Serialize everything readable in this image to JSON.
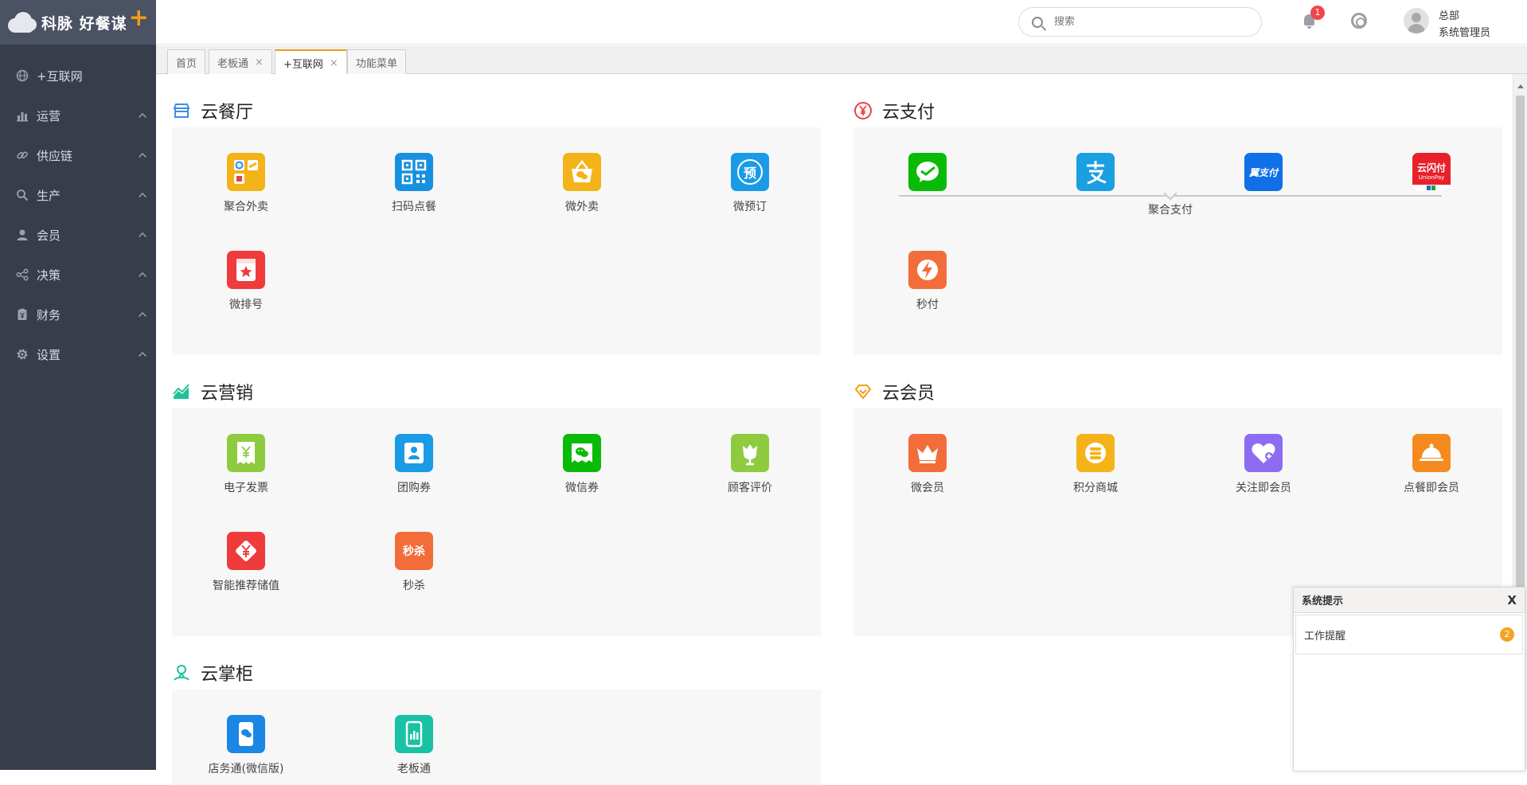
{
  "brand": {
    "name": "科脉 好餐谋",
    "plus": "+"
  },
  "sidebar": {
    "items": [
      {
        "label": "+互联网",
        "icon": "globe-icon"
      },
      {
        "label": "运营",
        "icon": "bar-chart-icon"
      },
      {
        "label": "供应链",
        "icon": "link-icon"
      },
      {
        "label": "生产",
        "icon": "search-icon"
      },
      {
        "label": "会员",
        "icon": "user-icon"
      },
      {
        "label": "决策",
        "icon": "share-icon"
      },
      {
        "label": "财务",
        "icon": "finance-icon"
      },
      {
        "label": "设置",
        "icon": "gear-icon"
      }
    ]
  },
  "header": {
    "search_placeholder": "搜索",
    "notification_count": "1",
    "user_org": "总部",
    "user_role": "系统管理员"
  },
  "tabs": [
    {
      "label": "首页"
    },
    {
      "label": "老板通",
      "close": "×"
    },
    {
      "label": "+互联网",
      "close": "×"
    },
    {
      "label": "功能菜单"
    }
  ],
  "sections": {
    "restaurant": {
      "title": "云餐厅",
      "apps": [
        "聚合外卖",
        "扫码点餐",
        "微外卖",
        "微预订",
        "微排号"
      ]
    },
    "payment": {
      "title": "云支付",
      "group_label": "聚合支付",
      "pay_icons": [
        "wechat-pay-icon",
        "alipay-icon",
        "翼支付",
        "云闪付"
      ],
      "apps": [
        "秒付"
      ]
    },
    "marketing": {
      "title": "云营销",
      "apps": [
        "电子发票",
        "团购券",
        "微信券",
        "顾客评价",
        "智能推荐储值",
        "秒杀"
      ],
      "seckill_text": "秒杀"
    },
    "member": {
      "title": "云会员",
      "apps": [
        "微会员",
        "积分商城",
        "关注即会员",
        "点餐即会员"
      ]
    },
    "manager": {
      "title": "云掌柜",
      "apps": [
        "店务通(微信版)",
        "老板通"
      ]
    }
  },
  "icon_texts": {
    "reserve": "预",
    "yifu": "翼支付",
    "unionpay": "云闪付",
    "unionpay_en": "UnionPay",
    "seckill": "秒杀"
  },
  "colors": {
    "sidebar_bg": "#373d4b",
    "accent": "#f29b1d",
    "badge": "#f0464b"
  },
  "notification": {
    "title": "系统提示",
    "close": "X",
    "row_label": "工作提醒",
    "row_count": "2"
  }
}
